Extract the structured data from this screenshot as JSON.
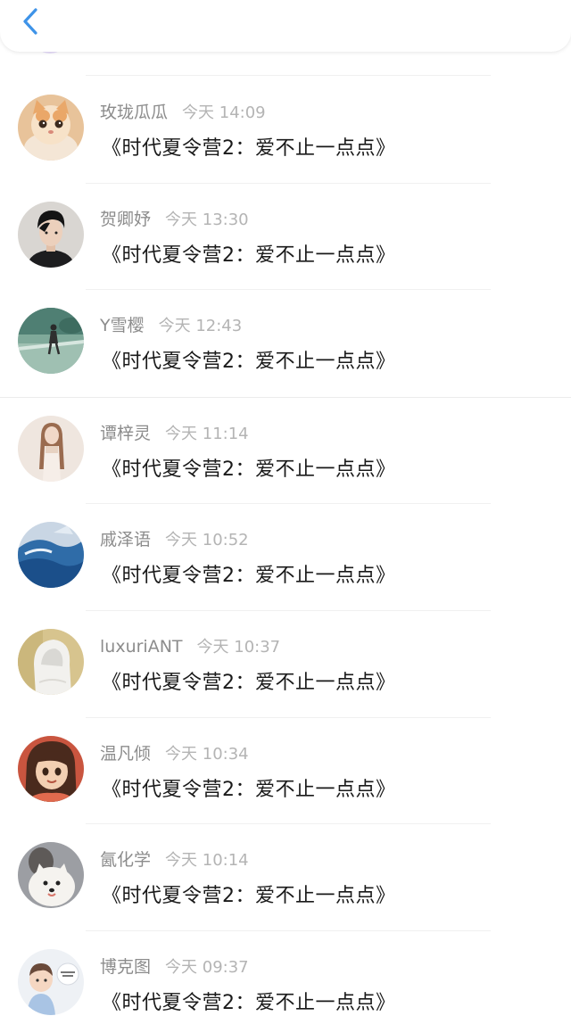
{
  "header": {
    "back_icon": "chevron-left-icon",
    "accent_color": "#3e93e8"
  },
  "messages": [
    {
      "name": "玫珑瓜瓜",
      "time": "今天 14:09",
      "text": "《时代夏令营2：爱不止一点点》",
      "avatar": "cat-avatar"
    },
    {
      "name": "贺卿妤",
      "time": "今天 13:30",
      "text": "《时代夏令营2：爱不止一点点》",
      "avatar": "boy-portrait-avatar"
    },
    {
      "name": "Y雪樱",
      "time": "今天 12:43",
      "text": "《时代夏令营2：爱不止一点点》",
      "avatar": "outdoor-photo-avatar"
    },
    {
      "name": "谭梓灵",
      "time": "今天 11:14",
      "text": "《时代夏令营2：爱不止一点点》",
      "avatar": "girl-photo-avatar"
    },
    {
      "name": "戚泽语",
      "time": "今天 10:52",
      "text": "《时代夏令营2：爱不止一点点》",
      "avatar": "ocean-avatar"
    },
    {
      "name": "luxuriANT",
      "time": "今天 10:37",
      "text": "《时代夏令营2：爱不止一点点》",
      "avatar": "hooded-figure-avatar"
    },
    {
      "name": "温凡倾",
      "time": "今天 10:34",
      "text": "《时代夏令营2：爱不止一点点》",
      "avatar": "anime-girl-avatar"
    },
    {
      "name": "氤化学",
      "time": "今天 10:14",
      "text": "《时代夏令营2：爱不止一点点》",
      "avatar": "white-dog-avatar"
    },
    {
      "name": "博克图",
      "time": "今天 09:37",
      "text": "《时代夏令营2：爱不止一点点》",
      "avatar": "cartoon-baby-avatar"
    }
  ]
}
